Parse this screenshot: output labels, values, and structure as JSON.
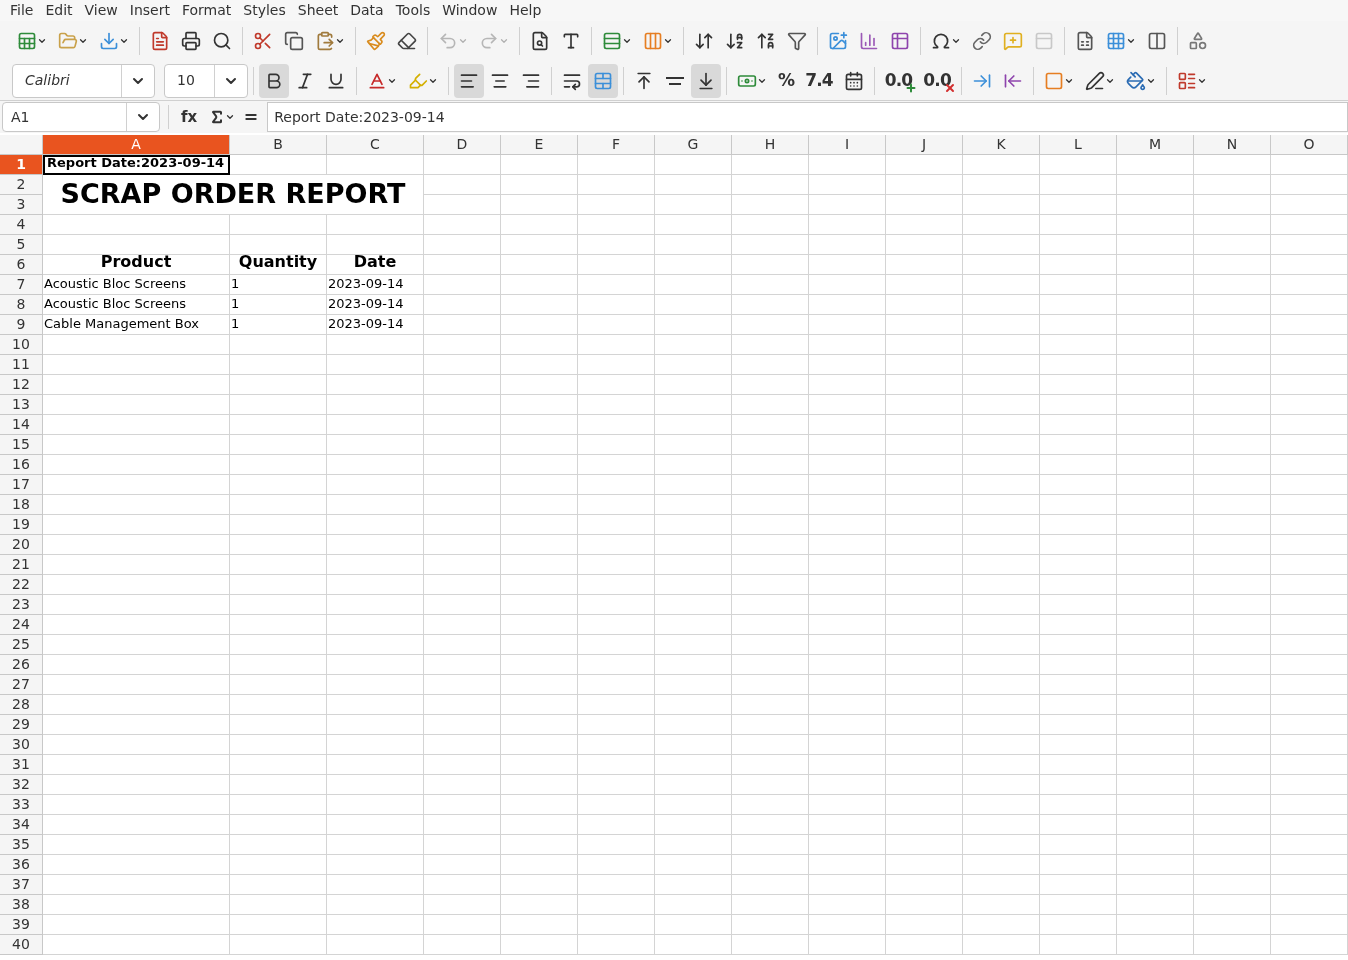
{
  "menu": [
    "File",
    "Edit",
    "View",
    "Insert",
    "Format",
    "Styles",
    "Sheet",
    "Data",
    "Tools",
    "Window",
    "Help"
  ],
  "standard_toolbar": [
    {
      "kind": "new",
      "dropdown": true,
      "disabled": false
    },
    {
      "kind": "open",
      "dropdown": true,
      "disabled": false
    },
    {
      "kind": "save",
      "dropdown": true,
      "disabled": false
    },
    {
      "kind": "separator"
    },
    {
      "kind": "pdf",
      "dropdown": false,
      "disabled": false
    },
    {
      "kind": "print",
      "dropdown": false,
      "disabled": false
    },
    {
      "kind": "preview",
      "dropdown": false,
      "disabled": false
    },
    {
      "kind": "separator"
    },
    {
      "kind": "cut",
      "dropdown": false,
      "disabled": false
    },
    {
      "kind": "copy",
      "dropdown": false,
      "disabled": false
    },
    {
      "kind": "paste",
      "dropdown": true,
      "disabled": false
    },
    {
      "kind": "separator"
    },
    {
      "kind": "clone",
      "dropdown": false,
      "disabled": false
    },
    {
      "kind": "clear",
      "dropdown": false,
      "disabled": false
    },
    {
      "kind": "separator"
    },
    {
      "kind": "undo",
      "dropdown": true,
      "disabled": true
    },
    {
      "kind": "redo",
      "dropdown": true,
      "disabled": true
    },
    {
      "kind": "separator"
    },
    {
      "kind": "find",
      "dropdown": false,
      "disabled": false
    },
    {
      "kind": "spelling",
      "dropdown": false,
      "disabled": false
    },
    {
      "kind": "separator"
    },
    {
      "kind": "row",
      "dropdown": true,
      "disabled": false
    },
    {
      "kind": "column",
      "dropdown": true,
      "disabled": false
    },
    {
      "kind": "separator"
    },
    {
      "kind": "sort",
      "dropdown": false,
      "disabled": false
    },
    {
      "kind": "ascending",
      "dropdown": false,
      "disabled": false
    },
    {
      "kind": "descending",
      "dropdown": false,
      "disabled": false
    },
    {
      "kind": "filter",
      "dropdown": false,
      "disabled": false
    },
    {
      "kind": "separator"
    },
    {
      "kind": "image",
      "dropdown": false,
      "disabled": false
    },
    {
      "kind": "chart",
      "dropdown": false,
      "disabled": false
    },
    {
      "kind": "pivot",
      "dropdown": false,
      "disabled": false
    },
    {
      "kind": "separator"
    },
    {
      "kind": "special",
      "dropdown": true,
      "disabled": false
    },
    {
      "kind": "link",
      "dropdown": false,
      "disabled": false
    },
    {
      "kind": "comment",
      "dropdown": false,
      "disabled": false
    },
    {
      "kind": "header",
      "dropdown": false,
      "disabled": true
    },
    {
      "kind": "separator"
    },
    {
      "kind": "printrange",
      "dropdown": false,
      "disabled": false
    },
    {
      "kind": "freeze",
      "dropdown": true,
      "disabled": false
    },
    {
      "kind": "split",
      "dropdown": false,
      "disabled": false
    },
    {
      "kind": "separator"
    },
    {
      "kind": "shapes",
      "dropdown": false,
      "disabled": false
    }
  ],
  "formatting_toolbar": {
    "font": "Calibri",
    "size": "10",
    "buttons": [
      {
        "kind": "bold",
        "pressed": true,
        "dropdown": false
      },
      {
        "kind": "italic",
        "pressed": false,
        "dropdown": false
      },
      {
        "kind": "underline",
        "pressed": false,
        "dropdown": false
      },
      {
        "kind": "separator"
      },
      {
        "kind": "fontcolor",
        "pressed": false,
        "dropdown": true
      },
      {
        "kind": "highlight",
        "pressed": false,
        "dropdown": true
      },
      {
        "kind": "separator"
      },
      {
        "kind": "left",
        "pressed": true,
        "dropdown": false
      },
      {
        "kind": "center",
        "pressed": false,
        "dropdown": false
      },
      {
        "kind": "right",
        "pressed": false,
        "dropdown": false
      },
      {
        "kind": "separator"
      },
      {
        "kind": "wrap",
        "pressed": false,
        "dropdown": false
      },
      {
        "kind": "merge",
        "pressed": true,
        "dropdown": false
      },
      {
        "kind": "separator"
      },
      {
        "kind": "top",
        "pressed": false,
        "dropdown": false
      },
      {
        "kind": "middle",
        "pressed": false,
        "dropdown": false
      },
      {
        "kind": "bottom",
        "pressed": true,
        "dropdown": false
      },
      {
        "kind": "separator"
      },
      {
        "kind": "currency",
        "pressed": false,
        "dropdown": true
      },
      {
        "kind": "percent",
        "label": "%",
        "pressed": false,
        "dropdown": false
      },
      {
        "kind": "number",
        "label": "7.4",
        "pressed": false,
        "dropdown": false
      },
      {
        "kind": "date",
        "pressed": false,
        "dropdown": false
      },
      {
        "kind": "separator"
      },
      {
        "kind": "adddecimal",
        "label": "0.0",
        "pressed": false,
        "dropdown": false
      },
      {
        "kind": "deldecimal",
        "label": "0.0",
        "pressed": false,
        "dropdown": false
      },
      {
        "kind": "separator"
      },
      {
        "kind": "indent",
        "pressed": false,
        "dropdown": false
      },
      {
        "kind": "outdent",
        "pressed": false,
        "dropdown": false
      },
      {
        "kind": "separator"
      },
      {
        "kind": "borders",
        "pressed": false,
        "dropdown": true
      },
      {
        "kind": "borderstyle",
        "pressed": false,
        "dropdown": true
      },
      {
        "kind": "bordercolor",
        "pressed": false,
        "dropdown": true
      },
      {
        "kind": "separator"
      },
      {
        "kind": "conditional",
        "pressed": false,
        "dropdown": true
      }
    ]
  },
  "formula_bar": {
    "name_box": "A1",
    "function_wizard": "fx",
    "value": "Report Date:2023-09-14"
  },
  "sheet": {
    "columns": [
      {
        "label": "A",
        "selected": true
      },
      {
        "label": "B",
        "selected": false
      },
      {
        "label": "C",
        "selected": false
      },
      {
        "label": "D",
        "selected": false
      },
      {
        "label": "E",
        "selected": false
      },
      {
        "label": "F",
        "selected": false
      },
      {
        "label": "G",
        "selected": false
      },
      {
        "label": "H",
        "selected": false
      },
      {
        "label": "I",
        "selected": false
      },
      {
        "label": "J",
        "selected": false
      },
      {
        "label": "K",
        "selected": false
      },
      {
        "label": "L",
        "selected": false
      },
      {
        "label": "M",
        "selected": false
      },
      {
        "label": "N",
        "selected": false
      },
      {
        "label": "O",
        "selected": false
      }
    ],
    "rows": [
      {
        "label": "1",
        "selected": true
      },
      {
        "label": "2",
        "selected": false
      },
      {
        "label": "3",
        "selected": false
      },
      {
        "label": "4",
        "selected": false
      },
      {
        "label": "5",
        "selected": false
      },
      {
        "label": "6",
        "selected": false
      },
      {
        "label": "7",
        "selected": false
      },
      {
        "label": "8",
        "selected": false
      },
      {
        "label": "9",
        "selected": false
      },
      {
        "label": "10",
        "selected": false
      },
      {
        "label": "11",
        "selected": false
      },
      {
        "label": "12",
        "selected": false
      },
      {
        "label": "13",
        "selected": false
      },
      {
        "label": "14",
        "selected": false
      },
      {
        "label": "15",
        "selected": false
      },
      {
        "label": "16",
        "selected": false
      },
      {
        "label": "17",
        "selected": false
      },
      {
        "label": "18",
        "selected": false
      },
      {
        "label": "19",
        "selected": false
      },
      {
        "label": "20",
        "selected": false
      },
      {
        "label": "21",
        "selected": false
      },
      {
        "label": "22",
        "selected": false
      },
      {
        "label": "23",
        "selected": false
      },
      {
        "label": "24",
        "selected": false
      },
      {
        "label": "25",
        "selected": false
      },
      {
        "label": "26",
        "selected": false
      },
      {
        "label": "27",
        "selected": false
      },
      {
        "label": "28",
        "selected": false
      },
      {
        "label": "29",
        "selected": false
      },
      {
        "label": "30",
        "selected": false
      },
      {
        "label": "31",
        "selected": false
      },
      {
        "label": "32",
        "selected": false
      },
      {
        "label": "33",
        "selected": false
      },
      {
        "label": "34",
        "selected": false
      },
      {
        "label": "35",
        "selected": false
      },
      {
        "label": "36",
        "selected": false
      },
      {
        "label": "37",
        "selected": false
      },
      {
        "label": "38",
        "selected": false
      },
      {
        "label": "39",
        "selected": false
      },
      {
        "label": "40",
        "selected": false
      }
    ],
    "report_date": {
      "text": "Report Date:2023-09-14",
      "selected": true
    },
    "title": "SCRAP ORDER REPORT",
    "table": {
      "columns": [
        "Product",
        "Quantity",
        "Date"
      ],
      "rows": [
        [
          "Acoustic Bloc Screens",
          "1",
          "2023-09-14"
        ],
        [
          "Acoustic Bloc Screens",
          "1",
          "2023-09-14"
        ],
        [
          "Cable Management Box",
          "1",
          "2023-09-14"
        ]
      ]
    }
  }
}
